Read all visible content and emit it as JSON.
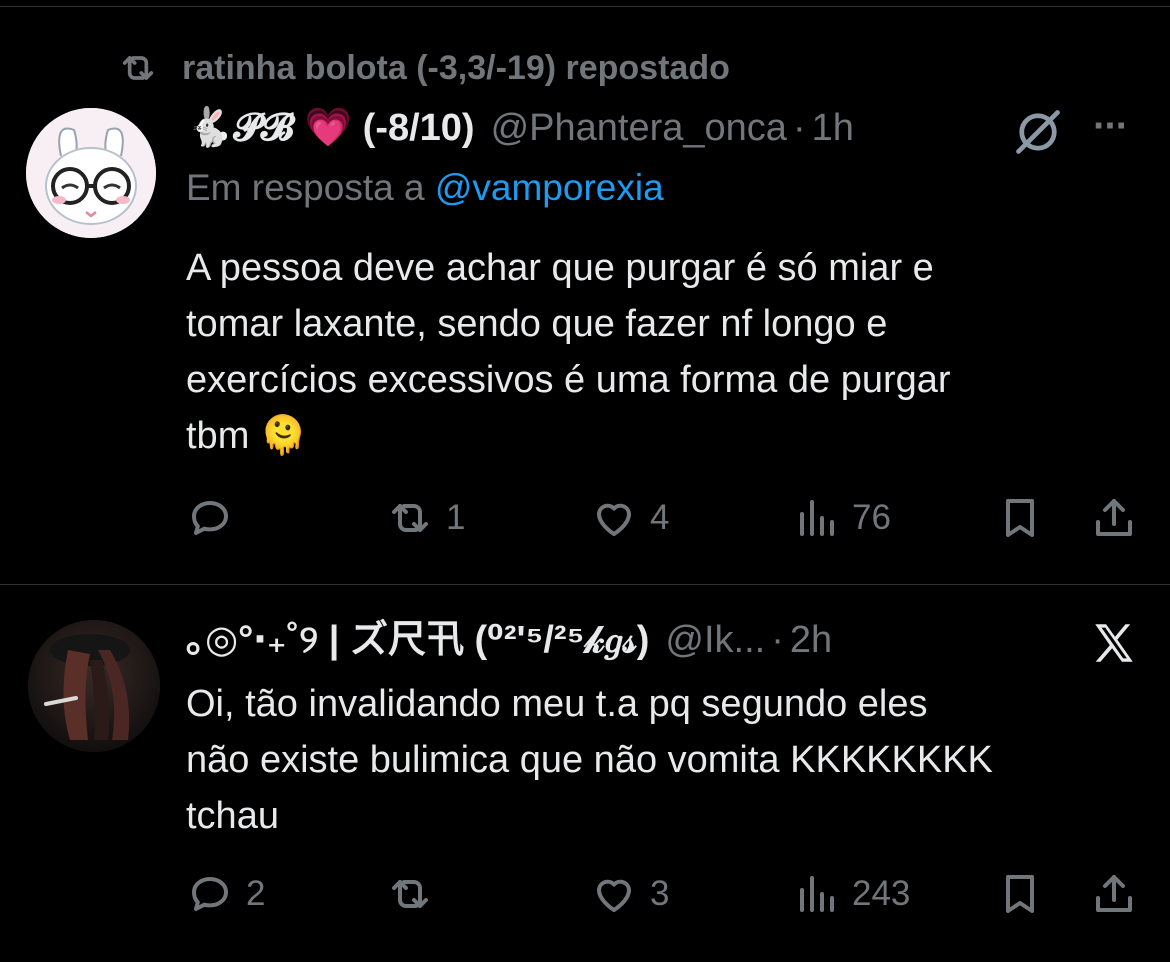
{
  "repost": {
    "icon": "repost-icon",
    "text": "ratinha bolota (-3,3/-19) repostado"
  },
  "posts": [
    {
      "name": "🐇𝓟𝓑 💗 (-8/10)",
      "handle": "@Phantera_onca",
      "dot": "·",
      "time": "1h",
      "reply_prefix": "Em resposta a",
      "reply_mention": "@vamporexia",
      "body_lines": [
        "A pessoa deve achar que purgar é só miar e",
        "tomar laxante, sendo que fazer nf longo e",
        "exercícios excessivos é uma forma de purgar",
        "tbm 🫠"
      ],
      "replies": "",
      "reposts": "1",
      "likes": "4",
      "views": "76",
      "right_icons": [
        "grok-icon",
        "more-icon"
      ],
      "more_text": "···"
    },
    {
      "name": "｡◎°‧₊˚୨ | ズ尺卂 (⁰²'⁵/²⁵𝓀𝑔𝓈)",
      "handle": "@Ik...",
      "dot": "·",
      "time": "2h",
      "body_lines": [
        "Oi, tão invalidando meu t.a pq segundo eles",
        "não existe bulimica que não vomita KKKKKKKK",
        "tchau"
      ],
      "replies": "2",
      "reposts": "",
      "likes": "3",
      "views": "243",
      "right_icons": [
        "x-logo-icon"
      ]
    }
  ],
  "colors": {
    "background": "#000000",
    "text": "#e7e9ea",
    "muted": "#71767b",
    "link": "#1d9bf0",
    "border": "#2f3336"
  }
}
